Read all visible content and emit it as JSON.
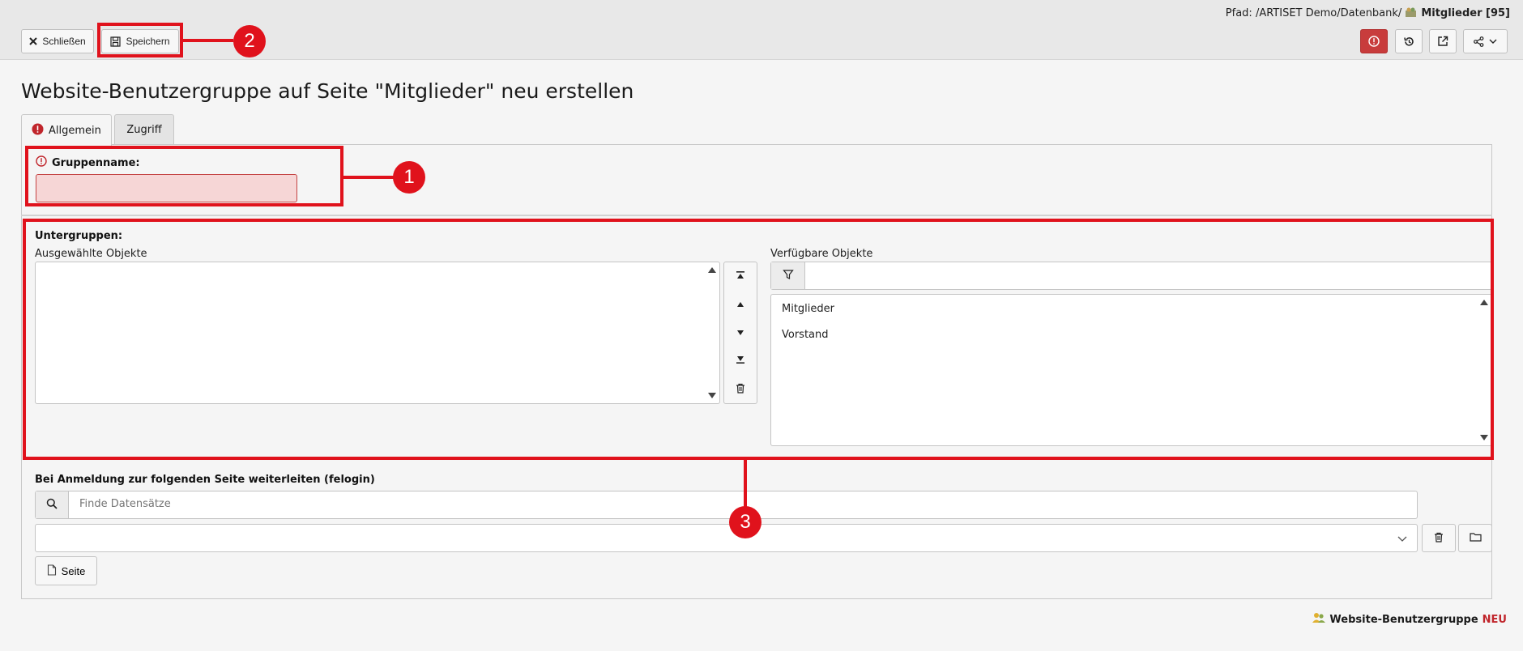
{
  "header": {
    "path_prefix": "Pfad: /ARTISET Demo/Datenbank/",
    "path_current": "Mitglieder [95]",
    "close_label": "Schließen",
    "save_label": "Speichern"
  },
  "page": {
    "title": "Website-Benutzergruppe auf Seite \"Mitglieder\" neu erstellen"
  },
  "tabs": [
    {
      "label": "Allgemein",
      "active": true
    },
    {
      "label": "Zugriff",
      "active": false
    }
  ],
  "form": {
    "group_name_label": "Gruppenname:",
    "group_name_value": "",
    "subgroups_label": "Untergruppen:",
    "selected_label": "Ausgewählte Objekte",
    "available_label": "Verfügbare Objekte",
    "available_items": [
      "Mitglieder",
      "Vorstand"
    ],
    "felogin_label": "Bei Anmeldung zur folgenden Seite weiterleiten (felogin)",
    "search_placeholder": "Finde Datensätze",
    "page_button_label": "Seite"
  },
  "footer": {
    "record_type": "Website-Benutzergruppe",
    "state": "NEU"
  },
  "annotations": [
    "1",
    "2",
    "3"
  ],
  "colors": {
    "accent_red": "#e0121c",
    "error_bg": "#f6d6d6",
    "alert_button": "#c83c3c"
  }
}
